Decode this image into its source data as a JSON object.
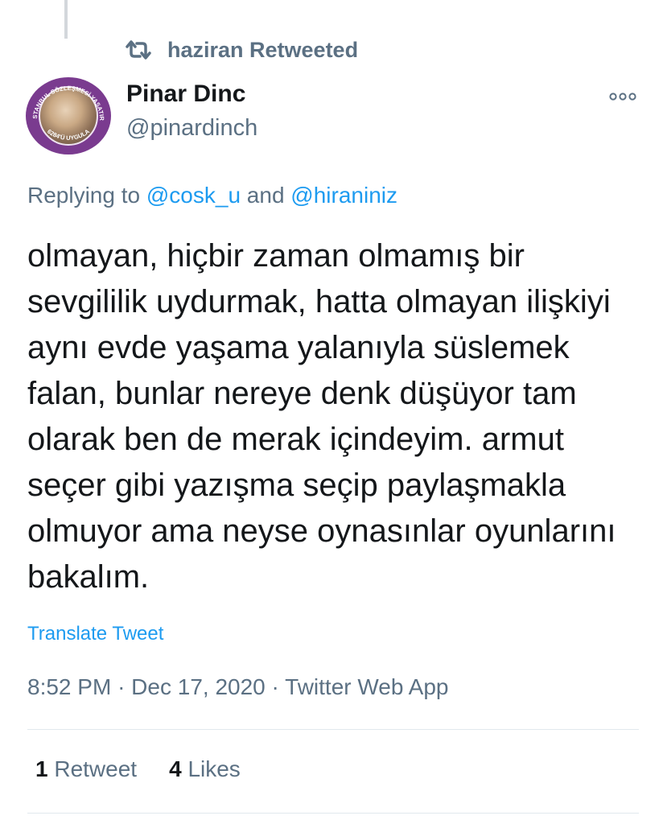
{
  "social_context": {
    "text": "haziran Retweeted",
    "icon": "retweet-icon"
  },
  "author": {
    "name": "Pinar Dinc",
    "handle": "@pinardinch",
    "avatar_ring_top": "İSTANBUL SÖZLEŞMESİ YAŞATIR",
    "avatar_ring_bottom": "6284'Ü UYGULA",
    "avatar_ring_color": "#7a3b8f"
  },
  "replying": {
    "prefix": "Replying to ",
    "mention1": "@cosk_u",
    "conjunction": " and ",
    "mention2": "@hiraniniz"
  },
  "tweet": {
    "text": "olmayan, hiçbir zaman olmamış bir sevgililik uydurmak, hatta olmayan ilişkiyi aynı evde yaşama yalanıyla süslemek  falan, bunlar nereye denk düşüyor tam olarak ben de merak içindeyim. armut seçer gibi yazışma seçip paylaşmakla olmuyor ama neyse oynasınlar oyunlarını bakalım.",
    "translate_label": "Translate Tweet",
    "time": "8:52 PM",
    "date": "Dec 17, 2020",
    "source": "Twitter Web App",
    "separator": "·"
  },
  "stats": {
    "retweets_count": "1",
    "retweets_label": "Retweet",
    "likes_count": "4",
    "likes_label": "Likes"
  },
  "colors": {
    "link": "#1d9bf0",
    "secondary_text": "#5b7083",
    "primary_text": "#14171a"
  }
}
